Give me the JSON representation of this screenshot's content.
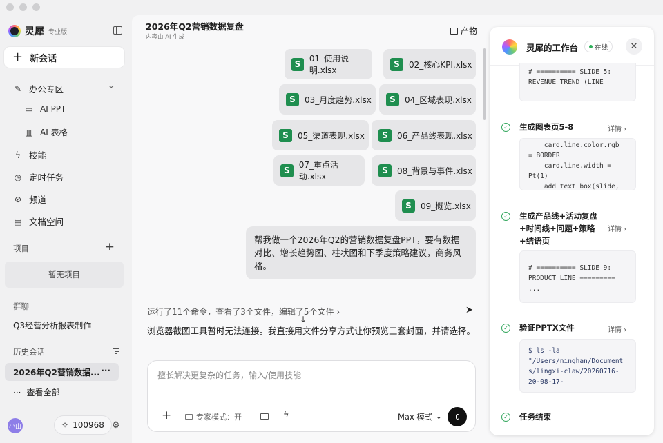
{
  "sidebar": {
    "brand": "灵犀",
    "brand_tag": "专业版",
    "new_chat": "新会话",
    "office": "办公专区",
    "ai_ppt": "AI PPT",
    "ai_table": "AI 表格",
    "skills": "技能",
    "scheduled": "定时任务",
    "channels": "频道",
    "docs": "文档空间",
    "projects_label": "项目",
    "no_projects": "暂无项目",
    "groups_label": "群聊",
    "group_item": "Q3经营分析报表制作",
    "history_label": "历史会话",
    "history_active": "2026年Q2营销数据...",
    "view_all": "查看全部",
    "avatar_text": "小山",
    "credits": "100968"
  },
  "main": {
    "title": "2026年Q2营销数据复盘",
    "subtitle": "内容由 AI 生成",
    "product_btn": "产物",
    "files": [
      "01_使用说明.xlsx",
      "02_核心KPI.xlsx",
      "03_月度趋势.xlsx",
      "04_区域表现.xlsx",
      "05_渠道表现.xlsx",
      "06_产品线表现.xlsx",
      "07_重点活动.xlsx",
      "08_背景与事件.xlsx",
      "09_概览.xlsx"
    ],
    "user_message": "帮我做一个2026年Q2的营销数据复盘PPT，要有数据对比、增长趋势图、柱状图和下季度策略建议，商务风格。",
    "ran_summary": "运行了11个命令，查看了3个文件，编辑了5个文件",
    "reply": "浏览器截图工具暂时无法连接。我直接用文件分享方式让你预览三套封面，并请选择。",
    "composer_placeholder": "擅长解决更复杂的任务，输入/使用技能",
    "expert_mode": "专家模式：开",
    "model_mode": "Max 模式"
  },
  "panel": {
    "title": "灵犀的工作台",
    "status": "在线",
    "code1": "# ========== SLIDE 5:\nREVENUE TREND (LINE",
    "step1": "生成图表页5-8",
    "code2": "    card.line.color.rgb\n= BORDER\n    card.line.width =\nPt(1)\n    add_text_box(slide,",
    "step2": "生成产品线+活动复盘\n+时间线+问题+策略\n+结语页",
    "code3": "\n# ========== SLIDE 9:\nPRODUCT LINE =========\n...",
    "step3": "验证PPTX文件",
    "code4": "$ ls -la\n\"/Users/ninghan/Document\ns/lingxi-claw/20260716-\n20-08-17-",
    "step4": "任务结束",
    "detail": "详情"
  }
}
